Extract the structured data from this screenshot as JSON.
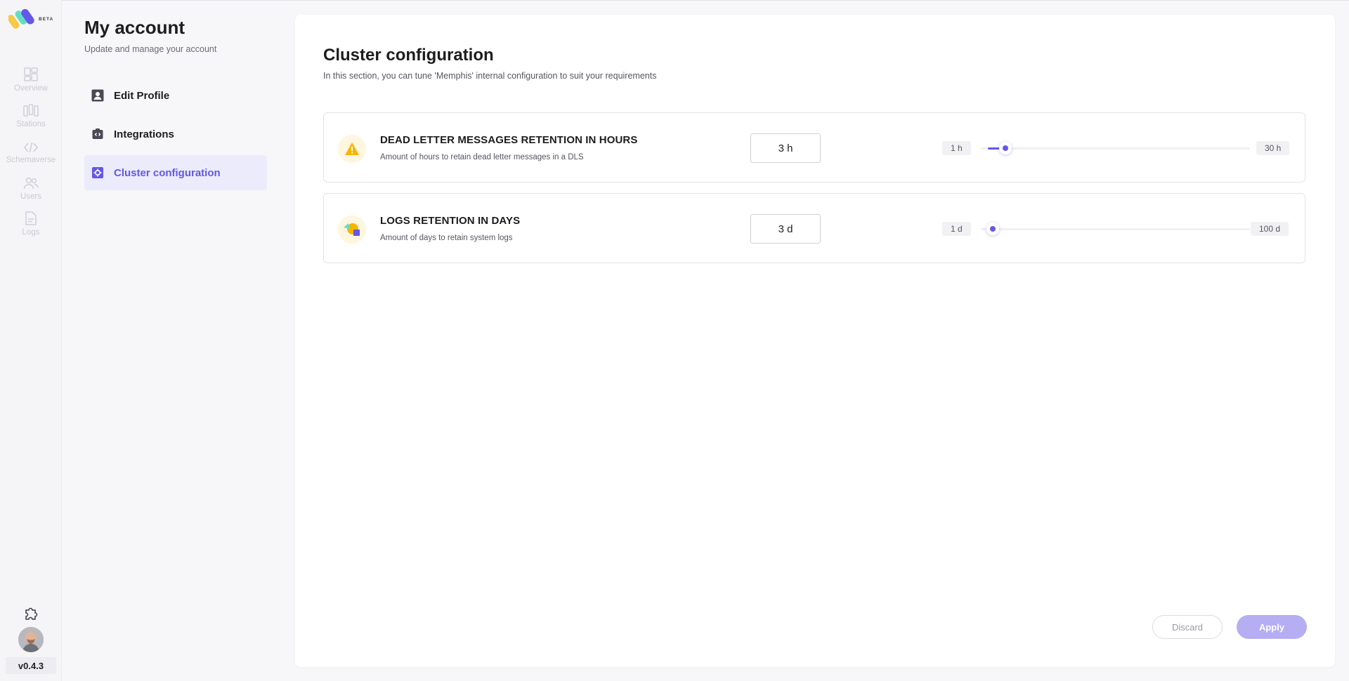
{
  "nav": {
    "logo_badge": "BETA",
    "items": [
      {
        "label": "Overview",
        "icon": "overview-icon"
      },
      {
        "label": "Stations",
        "icon": "stations-icon"
      },
      {
        "label": "Schemaverse",
        "icon": "code-icon"
      },
      {
        "label": "Users",
        "icon": "users-icon"
      },
      {
        "label": "Logs",
        "icon": "logs-icon"
      }
    ],
    "bottom_icon": "puzzle-icon",
    "version": "v0.4.3"
  },
  "account": {
    "title": "My account",
    "subtitle": "Update and manage your account",
    "menu": [
      {
        "label": "Edit Profile",
        "icon": "profile-icon"
      },
      {
        "label": "Integrations",
        "icon": "integrations-icon"
      },
      {
        "label": "Cluster configuration",
        "icon": "gear-icon",
        "active": true
      }
    ]
  },
  "main": {
    "title": "Cluster configuration",
    "subtitle": "In this section, you can tune 'Memphis' internal configuration to suit your requirements",
    "configs": [
      {
        "title": "DEAD LETTER MESSAGES RETENTION IN HOURS",
        "description": "Amount of hours to retain dead letter messages in a DLS",
        "value_display": "3 h",
        "value": 3,
        "min": 1,
        "max": 30,
        "min_label": "1 h",
        "max_label": "30 h",
        "icon": "warning-icon"
      },
      {
        "title": "LOGS RETENTION IN DAYS",
        "description": "Amount of days to retain system logs",
        "value_display": "3 d",
        "value": 3,
        "min": 1,
        "max": 100,
        "min_label": "1 d",
        "max_label": "100 d",
        "icon": "logs-shapes-icon"
      }
    ],
    "buttons": {
      "discard": "Discard",
      "apply": "Apply"
    }
  },
  "colors": {
    "accent": "#6557e8",
    "accent_light": "#ecebfc",
    "apply_disabled": "#b5aef3",
    "warning": "#f7b500"
  }
}
